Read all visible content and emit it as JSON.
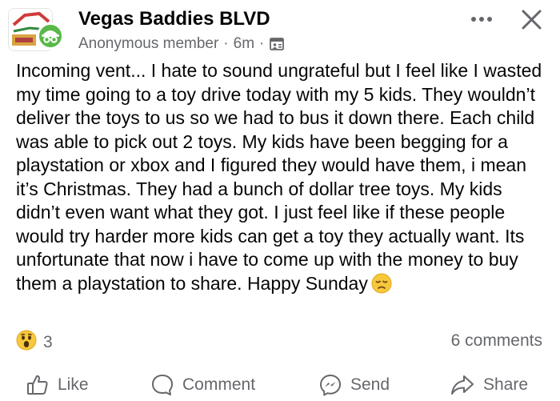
{
  "post": {
    "group_name": "Vegas Baddies BLVD",
    "author": "Anonymous member",
    "separator": "·",
    "time": "6m",
    "text": "Incoming vent... I hate to sound ungrateful but I feel like I wasted my time going to a toy drive today with my 5 kids. They wouldn’t deliver the toys to us so we had to bus it down there. Each child was able to pick out 2 toys. My kids have been begging for a playstation or xbox and I figured they would have them, i mean it’s Christmas. They had a bunch of dollar tree toys. My kids didn’t even want what they got. I just feel like if these people would try harder more kids can get a toy they actually want. Its unfortunate that now i have to come up with the money to buy them a playstation to share. Happy Sunday",
    "reaction_count": "3",
    "comments_count": "6 comments"
  },
  "actions": {
    "like": "Like",
    "comment": "Comment",
    "send": "Send",
    "share": "Share"
  },
  "icons": {
    "group": "group-avatar-icon",
    "anonymous": "anonymous-badge-icon",
    "privacy": "group-privacy-icon",
    "more": "more-options-icon",
    "close": "close-icon",
    "reaction": "wow-reaction-icon",
    "sad": "disappointed-emoji-icon"
  },
  "colors": {
    "text": "#050505",
    "secondary": "#65676b",
    "anonymous_badge": "#58b848"
  }
}
